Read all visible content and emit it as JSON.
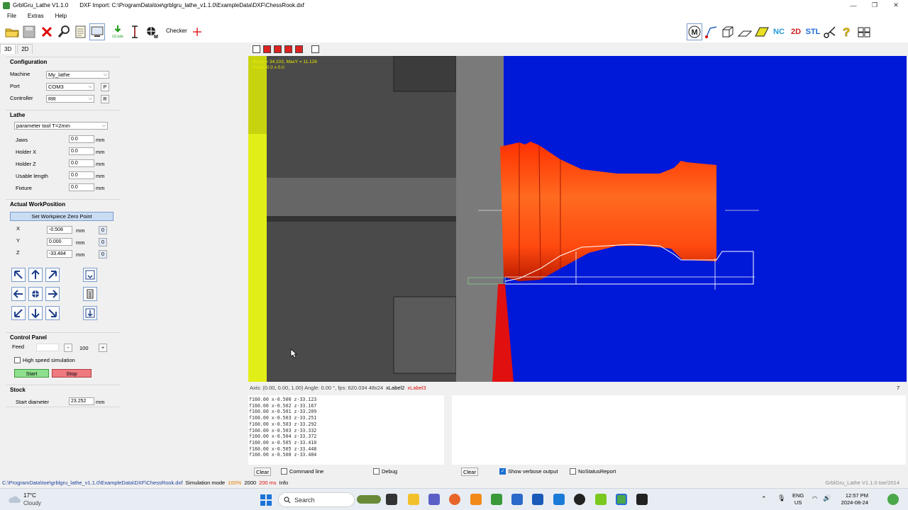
{
  "window": {
    "app_title": "GrblGru_Lathe V1.1.0",
    "doc_title": "DXF Import: C:\\ProgramData\\toe\\grblgru_lathe_v1.1.0\\ExampleData\\DXF\\ChessRook.dxf",
    "minimize": "—",
    "maximize": "❐",
    "close": "✕"
  },
  "menu": [
    "File",
    "Extras",
    "Help"
  ],
  "toolbar": {
    "checker_label": "Checker",
    "gcode_label": "GCode",
    "right_labels": {
      "nc": "NC",
      "twod": "2D",
      "stl": "STL",
      "m": "M"
    }
  },
  "left_tabs": [
    "3D",
    "2D"
  ],
  "configuration": {
    "title": "Configuration",
    "machine_label": "Machine",
    "machine_value": "My_lathe",
    "port_label": "Port",
    "port_value": "COM3",
    "port_btn": "P",
    "controller_label": "Controller",
    "controller_value": "RR",
    "controller_btn": "R"
  },
  "lathe": {
    "title": "Lathe",
    "tool_value": "parameter tool T=2mm",
    "rows": [
      {
        "label": "Jaws",
        "value": "0.0",
        "unit": "mm"
      },
      {
        "label": "Holder X",
        "value": "0.0",
        "unit": "mm"
      },
      {
        "label": "Holder Z",
        "value": "0.0",
        "unit": "mm"
      },
      {
        "label": "Usable length",
        "value": "0.0",
        "unit": "mm"
      },
      {
        "label": "Fixture",
        "value": "0.0",
        "unit": "mm"
      }
    ]
  },
  "workposition": {
    "title": "Actual WorkPosition",
    "zero_btn": "Set Workpiece Zero Point",
    "axes": [
      {
        "label": "X",
        "value": "-0.508",
        "unit": "mm",
        "zero": "0"
      },
      {
        "label": "Y",
        "value": "0.000",
        "unit": "mm",
        "zero": "0"
      },
      {
        "label": "Z",
        "value": "-33.484",
        "unit": "mm",
        "zero": "0"
      }
    ]
  },
  "control_panel": {
    "title": "Control Panel",
    "feed_label": "Feed",
    "minus": "-",
    "feed_value": "100",
    "plus": "+",
    "high_speed_label": "High speed simulation",
    "start": "Start",
    "stop": "Stop"
  },
  "stock": {
    "title": "Stock",
    "start_diameter_label": "Start diameter",
    "start_diameter_value": "23.252",
    "unit": "mm"
  },
  "viewport": {
    "overlay_line1": "MaxX = 34.103, MaxY = 11.126",
    "overlay_line2": "Stock:  0.0 x 0.0"
  },
  "status_line": {
    "text": "Axis: (0.00, 0.00, 1.00) Angle: 0.00 °, fps: 620.034   48x24",
    "label2": "xLabel2",
    "label3": "xLabel3",
    "right": "7"
  },
  "log_lines": [
    "f160.00 x-0.500 z-33.123",
    "f160.00 x-0.502 z-33.167",
    "f160.00 x-0.501 z-33.209",
    "f160.00 x-0.503 z-33.251",
    "f160.00 x-0.503 z-33.292",
    "f160.00 x-0.503 z-33.332",
    "f160.00 x-0.504 z-33.372",
    "f160.00 x-0.505 z-33.410",
    "f160.00 x-0.505 z-33.448",
    "f160.00 x-0.508 z-33.484"
  ],
  "log_controls": {
    "clear": "Clear",
    "command_line": "Command line",
    "debug": "Debug",
    "clear2": "Clear",
    "verbose": "Show verbose output",
    "no_status": "NoStatusReport"
  },
  "statusbar": {
    "path": "C:\\ProgramData\\toe\\grblgru_lathe_v1.1.0\\ExampleData\\DXF\\ChessRook.dxf",
    "mode": "Simulation mode",
    "pct": "100%",
    "val": "2000",
    "ms": "200 ms",
    "info": "Info",
    "right": "GrblGru_Lathe V1.1.0 toe/2014"
  },
  "taskbar": {
    "temp": "17°C",
    "weather": "Cloudy",
    "search": "Search",
    "lang1": "ENG",
    "lang2": "US",
    "time": "12:57 PM",
    "date": "2024-08-24"
  },
  "colors": {
    "viewport_bg": "#0018d8",
    "part_orange": "#ff4a10",
    "tool_red": "#e01010",
    "chuck_yellow": "#e2ee18",
    "start_btn": "#8ee08e",
    "stop_btn": "#ee7a80"
  }
}
